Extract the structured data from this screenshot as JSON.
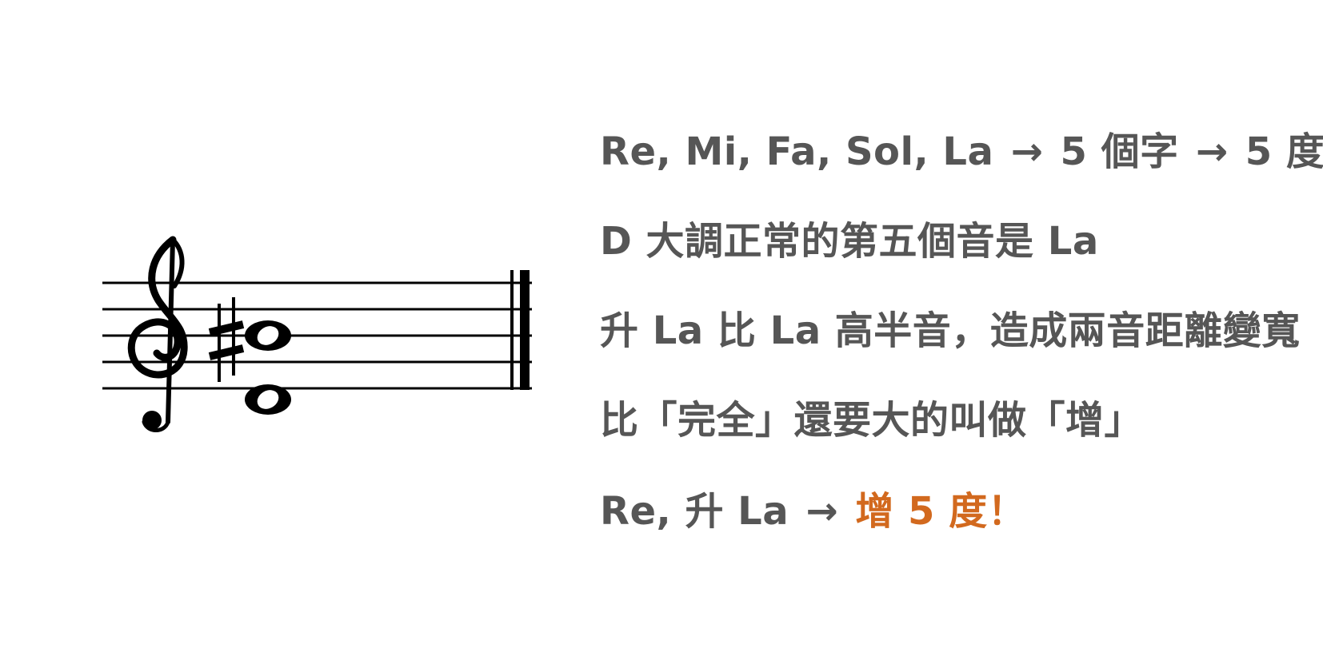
{
  "explanation": {
    "line1": {
      "part1": "Re, Mi, Fa, Sol, La",
      "arrow1": "→",
      "part2": "5 個字",
      "arrow2": "→",
      "part3": "5 度"
    },
    "line2": "D 大調正常的第五個音是 La",
    "line3": "升 La 比 La 高半音，造成兩音距離變寬",
    "line4": "比「完全」還要大的叫做「增」",
    "line5": {
      "part1": "Re, 升 La",
      "arrow": "→",
      "conclusion": "增 5 度！"
    }
  },
  "colors": {
    "text": "#565656",
    "highlight": "#d2691e",
    "notation": "#000000"
  },
  "notation": {
    "clef": "treble-clef",
    "accidental": "sharp",
    "notes": [
      "D",
      "A♯"
    ],
    "barline": "final-barline"
  }
}
